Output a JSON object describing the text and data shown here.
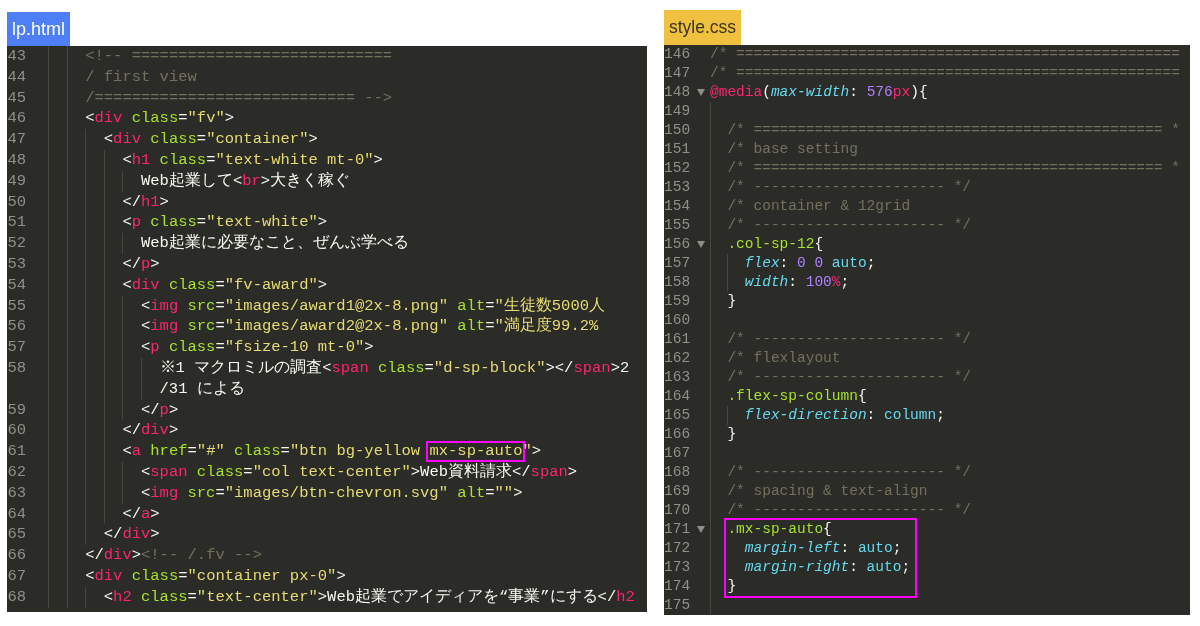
{
  "panels": [
    {
      "kind": "html",
      "file_label": "lp.html",
      "color": "#4f7ff6",
      "lines": [
        {
          "number": "43",
          "code": "    <!-- ============================"
        },
        {
          "number": "44",
          "code": "    / first view"
        },
        {
          "number": "45",
          "code": "    /============================ -->"
        },
        {
          "number": "46",
          "code": "    <div class=\"fv\">"
        },
        {
          "number": "47",
          "code": "      <div class=\"container\">"
        },
        {
          "number": "48",
          "code": "        <h1 class=\"text-white mt-0\">"
        },
        {
          "number": "49",
          "code": "          Web起業して<br>大きく稼ぐ"
        },
        {
          "number": "50",
          "code": "        </h1>"
        },
        {
          "number": "51",
          "code": "        <p class=\"text-white\">"
        },
        {
          "number": "52",
          "code": "          Web起業に必要なこと、ぜんぶ学べる"
        },
        {
          "number": "53",
          "code": "        </p>"
        },
        {
          "number": "54",
          "code": "        <div class=\"fv-award\">"
        },
        {
          "number": "55",
          "code": "          <img src=\"images/award1@2x-8.png\" alt=\"生徒数5000人"
        },
        {
          "number": "56",
          "code": "          <img src=\"images/award2@2x-8.png\" alt=\"満足度99.2%"
        },
        {
          "number": "57",
          "code": "          <p class=\"fsize-10 mt-0\">"
        },
        {
          "number": "58",
          "code": "            ※1 マクロミルの調査<span class=\"d-sp-block\"></span>2",
          "wrap": "/31 による"
        },
        {
          "number": "59",
          "code": "          </p>"
        },
        {
          "number": "60",
          "code": "        </div>"
        },
        {
          "number": "61",
          "parts": [
            {
              "text": "        <a href=\"#\" class=\"btn bg-yellow ",
              "marked": false
            },
            {
              "text": "mx-sp-auto",
              "marked": true
            },
            {
              "text": "\">",
              "marked": false
            }
          ]
        },
        {
          "number": "62",
          "code": "          <span class=\"col text-center\">Web資料請求</span>"
        },
        {
          "number": "63",
          "code": "          <img src=\"images/btn-chevron.svg\" alt=\"\">"
        },
        {
          "number": "64",
          "code": "        </a>"
        },
        {
          "number": "65",
          "code": "      </div>"
        },
        {
          "number": "66",
          "code": "    </div><!-- /.fv -->"
        },
        {
          "number": "67",
          "code": "    <div class=\"container px-0\">"
        },
        {
          "number": "68",
          "code": "      <h2 class=\"text-center\">Web起業でアイディアを“事業”にする</h2"
        }
      ]
    },
    {
      "kind": "css",
      "file_label": "style.css",
      "color": "#f0c13e",
      "lines": [
        {
          "number": "146",
          "code": "/* ===================================================",
          "fold_marker": false,
          "marked": false
        },
        {
          "number": "147",
          "code": "/* ===================================================",
          "fold_marker": false,
          "marked": false
        },
        {
          "number": "148",
          "code": "@media(max-width: 576px){",
          "fold_marker": true,
          "marked": false
        },
        {
          "number": "149",
          "fold_marker": false,
          "marked": false
        },
        {
          "number": "150",
          "code": "  /* =============================================== *",
          "fold_marker": false,
          "marked": false
        },
        {
          "number": "151",
          "code": "  /* base setting",
          "fold_marker": false,
          "marked": false
        },
        {
          "number": "152",
          "code": "  /* =============================================== *",
          "fold_marker": false,
          "marked": false
        },
        {
          "number": "153",
          "code": "  /* ---------------------- */",
          "fold_marker": false,
          "marked": false
        },
        {
          "number": "154",
          "code": "  /* container & 12grid",
          "fold_marker": false,
          "marked": false
        },
        {
          "number": "155",
          "code": "  /* ---------------------- */",
          "fold_marker": false,
          "marked": false
        },
        {
          "number": "156",
          "code": "  .col-sp-12{",
          "fold_marker": true,
          "marked": false
        },
        {
          "number": "157",
          "code": "    flex: 0 0 auto;",
          "fold_marker": false,
          "marked": false
        },
        {
          "number": "158",
          "code": "    width: 100%;",
          "fold_marker": false,
          "marked": false
        },
        {
          "number": "159",
          "code": "  }",
          "fold_marker": false,
          "marked": false
        },
        {
          "number": "160",
          "fold_marker": false,
          "marked": false
        },
        {
          "number": "161",
          "code": "  /* ---------------------- */",
          "fold_marker": false,
          "marked": false
        },
        {
          "number": "162",
          "code": "  /* flexlayout",
          "fold_marker": false,
          "marked": false
        },
        {
          "number": "163",
          "code": "  /* ---------------------- */",
          "fold_marker": false,
          "marked": false
        },
        {
          "number": "164",
          "code": "  .flex-sp-column{",
          "fold_marker": false,
          "marked": false
        },
        {
          "number": "165",
          "code": "    flex-direction: column;",
          "fold_marker": false,
          "marked": false
        },
        {
          "number": "166",
          "code": "  }",
          "fold_marker": false,
          "marked": false
        },
        {
          "number": "167",
          "fold_marker": false,
          "marked": false
        },
        {
          "number": "168",
          "code": "  /* ---------------------- */",
          "fold_marker": false,
          "marked": false
        },
        {
          "number": "169",
          "code": "  /* spacing & text-align",
          "fold_marker": false,
          "marked": false
        },
        {
          "number": "170",
          "code": "  /* ---------------------- */",
          "fold_marker": false,
          "marked": false
        },
        {
          "number": "171",
          "code": "  .mx-sp-auto{",
          "fold_marker": true,
          "marked": true
        },
        {
          "number": "172",
          "code": "    margin-left: auto;",
          "fold_marker": false,
          "marked": true
        },
        {
          "number": "173",
          "code": "    margin-right: auto;",
          "fold_marker": false,
          "marked": true
        },
        {
          "number": "174",
          "code": "  }",
          "fold_marker": false,
          "marked": true
        },
        {
          "number": "175",
          "fold_marker": false,
          "marked": false
        }
      ]
    }
  ]
}
